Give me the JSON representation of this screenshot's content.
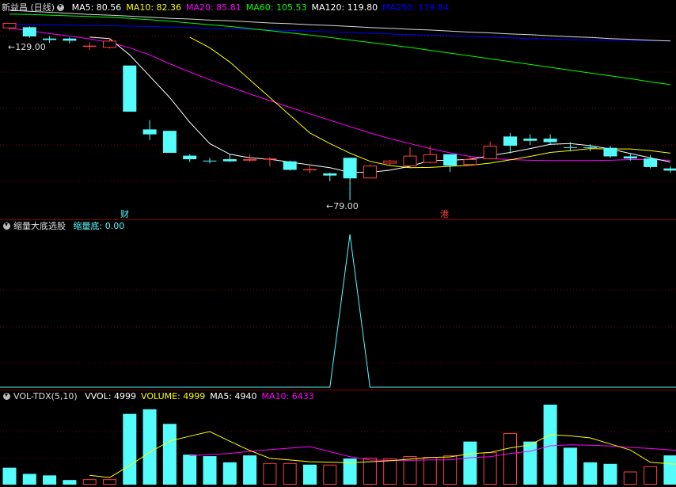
{
  "colors": {
    "up": "#ff4040",
    "down": "#54fcfc",
    "ma5": "#ffffff",
    "ma10": "#ffff00",
    "ma20": "#ff00ff",
    "ma60": "#00ff00",
    "ma120": "#ffffff",
    "ma250": "#0000ff",
    "grid": "#7a0000"
  },
  "main": {
    "title": "新益昌 (日线)",
    "indicators": [
      {
        "label": "MA5: 80.56",
        "color": "#ffffff"
      },
      {
        "label": "MA10: 82.36",
        "color": "#ffff00"
      },
      {
        "label": "MA20: 85.81",
        "color": "#ff00ff"
      },
      {
        "label": "MA60: 105.53",
        "color": "#00ff00"
      },
      {
        "label": "MA120: 119.80",
        "color": "#ffffff"
      },
      {
        "label": "MA250: 119.84",
        "color": "#0000ff"
      }
    ],
    "high_label": "129.00",
    "low_label": "79.00",
    "tag_cai": "财",
    "tag_gang": "港"
  },
  "middle": {
    "title": "缩量大底选股",
    "value_label": "缩量底: 0.00"
  },
  "volume": {
    "title": "VOL-TDX(5,10)",
    "indicators": [
      {
        "label": "VVOL: 4999",
        "color": "#ffffff"
      },
      {
        "label": "VOLUME: 4999",
        "color": "#ffff00"
      },
      {
        "label": "MA5: 4940",
        "color": "#ffffff"
      },
      {
        "label": "MA10: 6433",
        "color": "#ff00ff"
      }
    ]
  },
  "chart_data": {
    "type": "candlestick",
    "y_range": [
      77,
      131
    ],
    "candles": [
      {
        "o": 127.5,
        "c": 129.0,
        "h": 129.0,
        "l": 127.0
      },
      {
        "o": 127.8,
        "c": 125.2,
        "h": 128.0,
        "l": 124.8
      },
      {
        "o": 124.6,
        "c": 124.2,
        "h": 125.3,
        "l": 123.4
      },
      {
        "o": 124.6,
        "c": 124.0,
        "h": 125.0,
        "l": 123.2
      },
      {
        "o": 122.4,
        "c": 122.6,
        "h": 123.6,
        "l": 121.4
      },
      {
        "o": 122.0,
        "c": 124.0,
        "h": 124.8,
        "l": 121.8
      },
      {
        "o": 117.0,
        "c": 104.0,
        "h": 117.0,
        "l": 104.0
      },
      {
        "o": 99.0,
        "c": 97.6,
        "h": 101.6,
        "l": 96.0
      },
      {
        "o": 98.6,
        "c": 92.4,
        "h": 98.6,
        "l": 92.4
      },
      {
        "o": 91.6,
        "c": 90.6,
        "h": 92.0,
        "l": 89.8
      },
      {
        "o": 90.2,
        "c": 90.0,
        "h": 91.0,
        "l": 89.4
      },
      {
        "o": 90.6,
        "c": 90.0,
        "h": 92.0,
        "l": 89.8
      },
      {
        "o": 90.2,
        "c": 90.6,
        "h": 92.0,
        "l": 89.9
      },
      {
        "o": 90.6,
        "c": 90.8,
        "h": 91.2,
        "l": 88.6
      },
      {
        "o": 90.0,
        "c": 87.6,
        "h": 90.2,
        "l": 87.4
      },
      {
        "o": 87.6,
        "c": 87.8,
        "h": 88.6,
        "l": 86.6
      },
      {
        "o": 86.6,
        "c": 86.0,
        "h": 86.8,
        "l": 84.4
      },
      {
        "o": 91.0,
        "c": 85.2,
        "h": 91.0,
        "l": 79.0
      },
      {
        "o": 85.2,
        "c": 88.8,
        "h": 89.0,
        "l": 85.2
      },
      {
        "o": 89.4,
        "c": 90.2,
        "h": 90.4,
        "l": 88.6
      },
      {
        "o": 88.6,
        "c": 91.6,
        "h": 94.0,
        "l": 88.6
      },
      {
        "o": 89.6,
        "c": 92.0,
        "h": 94.4,
        "l": 89.4
      },
      {
        "o": 92.0,
        "c": 88.8,
        "h": 92.0,
        "l": 87.0
      },
      {
        "o": 89.0,
        "c": 90.6,
        "h": 91.4,
        "l": 88.8
      },
      {
        "o": 90.6,
        "c": 94.4,
        "h": 95.6,
        "l": 90.6
      },
      {
        "o": 97.0,
        "c": 94.4,
        "h": 98.0,
        "l": 92.2
      },
      {
        "o": 96.4,
        "c": 95.8,
        "h": 97.6,
        "l": 94.6
      },
      {
        "o": 96.4,
        "c": 95.4,
        "h": 97.6,
        "l": 94.6
      },
      {
        "o": 94.0,
        "c": 93.8,
        "h": 95.4,
        "l": 92.8
      },
      {
        "o": 94.0,
        "c": 93.8,
        "h": 94.8,
        "l": 92.8
      },
      {
        "o": 93.8,
        "c": 91.4,
        "h": 94.4,
        "l": 91.0
      },
      {
        "o": 91.4,
        "c": 90.8,
        "h": 92.4,
        "l": 90.2
      },
      {
        "o": 90.8,
        "c": 88.4,
        "h": 91.8,
        "l": 88.0
      },
      {
        "o": 88.0,
        "c": 87.4,
        "h": 88.6,
        "l": 86.8
      }
    ],
    "ma5": [
      null,
      null,
      null,
      null,
      125,
      124.6,
      120,
      114,
      108,
      101,
      95,
      92,
      91,
      90.6,
      89.8,
      89,
      88.2,
      86.9,
      86.9,
      87.5,
      88.6,
      90.2,
      90.3,
      90.6,
      91.6,
      92.5,
      93.6,
      94.8,
      95,
      94.4,
      93.5,
      92.2,
      91,
      89.8
    ],
    "ma10": [
      null,
      null,
      null,
      null,
      null,
      null,
      null,
      null,
      null,
      125,
      122,
      118,
      113,
      108,
      103,
      98,
      95,
      92.3,
      90,
      88.8,
      88.2,
      88.3,
      88.6,
      88.9,
      89.5,
      90.4,
      91.4,
      92.5,
      93,
      93.6,
      93.5,
      93.5,
      93,
      92.3
    ],
    "ma20": [
      127.5,
      126.8,
      126,
      125.3,
      124.5,
      123.5,
      122,
      120,
      117.5,
      115.2,
      113,
      111,
      109,
      107.1,
      105.2,
      103.4,
      101.6,
      99.8,
      98,
      96.4,
      95,
      93.6,
      92.4,
      91.4,
      90.8,
      90.5,
      90.3,
      90.2,
      90.2,
      90.2,
      90.3,
      90.5,
      90.5,
      90.3
    ],
    "ma60": [
      131.5,
      131.4,
      131.2,
      131,
      130.8,
      130.6,
      130.3,
      129.9,
      129.5,
      129,
      128.5,
      128,
      127.4,
      126.8,
      126.2,
      125.6,
      124.9,
      124.2,
      123.5,
      122.8,
      122.1,
      121.3,
      120.5,
      119.7,
      118.9,
      118.1,
      117.3,
      116.5,
      115.7,
      114.9,
      114.1,
      113.3,
      112.4,
      111.6
    ],
    "ma120": [
      132.6,
      132.3,
      132,
      131.7,
      131.4,
      131.2,
      130.9,
      130.6,
      130.3,
      130.1,
      129.8,
      129.6,
      129.3,
      129,
      128.8,
      128.5,
      128.3,
      128,
      127.7,
      127.5,
      127.2,
      127,
      126.7,
      126.4,
      126.2,
      125.9,
      125.7,
      125.4,
      125.1,
      124.9,
      124.6,
      124.4,
      124.1,
      123.9
    ],
    "ma250": [
      128.6,
      128.5,
      128.5,
      128.4,
      128.3,
      128.2,
      128.1,
      128,
      127.8,
      127.7,
      127.5,
      127.4,
      127.2,
      127,
      126.9,
      126.7,
      126.5,
      126.3,
      126.1,
      125.9,
      125.7,
      125.5,
      125.4,
      125.2,
      125,
      124.8,
      124.6,
      124.5,
      124.3,
      124.2,
      124.1,
      124.1,
      124,
      124
    ],
    "signal_peak_index": 17,
    "volume": [
      2200,
      1400,
      1200,
      600,
      700,
      700,
      9200,
      9800,
      7900,
      3900,
      3700,
      2900,
      3800,
      2800,
      2800,
      2600,
      2600,
      3400,
      3500,
      3400,
      3700,
      3600,
      3800,
      5600,
      4200,
      6700,
      5600,
      10400,
      4800,
      2900,
      2700,
      1700,
      2400,
      3800,
      2200
    ],
    "volume_up": [
      false,
      false,
      false,
      false,
      true,
      true,
      false,
      false,
      false,
      false,
      false,
      false,
      false,
      true,
      true,
      false,
      true,
      false,
      true,
      true,
      true,
      true,
      true,
      false,
      true,
      true,
      false,
      false,
      false,
      false,
      false,
      true,
      true,
      false,
      false
    ]
  }
}
